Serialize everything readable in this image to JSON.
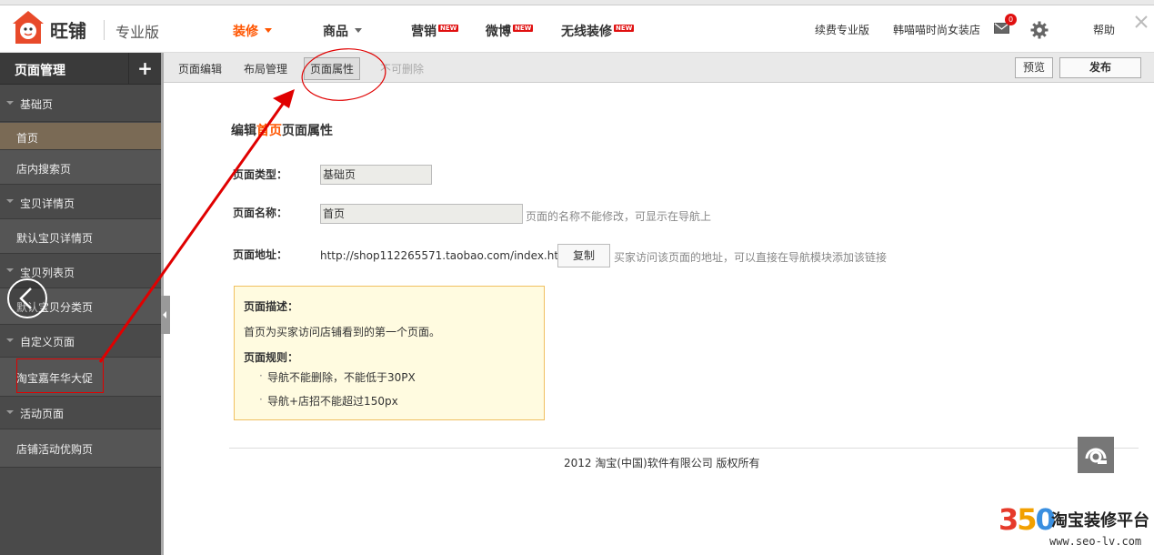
{
  "header": {
    "brand": "旺铺",
    "edition": "专业版",
    "nav": [
      {
        "label": "装修",
        "active": true,
        "has_caret": true,
        "new": false
      },
      {
        "label": "商品",
        "active": false,
        "has_caret": true,
        "new": false
      },
      {
        "label": "营销",
        "active": false,
        "has_caret": false,
        "new": true
      },
      {
        "label": "微博",
        "active": false,
        "has_caret": false,
        "new": true
      },
      {
        "label": "无线装修",
        "active": false,
        "has_caret": false,
        "new": true
      }
    ],
    "new_badge": "NEW",
    "renew": "续费专业版",
    "shop_name": "韩喵喵时尚女装店",
    "mail_count": "0",
    "help": "帮助"
  },
  "sidebar": {
    "title": "页面管理",
    "add_label": "+",
    "rows": [
      {
        "label": "基础页",
        "type": "group"
      },
      {
        "label": "首页",
        "type": "selected"
      },
      {
        "label": "店内搜索页",
        "type": "sub"
      },
      {
        "label": "宝贝详情页",
        "type": "group"
      },
      {
        "label": "默认宝贝详情页",
        "type": "sub"
      },
      {
        "label": "宝贝列表页",
        "type": "group"
      },
      {
        "label": "默认宝贝分类页",
        "type": "sub"
      },
      {
        "label": "自定义页面",
        "type": "group"
      },
      {
        "label": "淘宝嘉年华大促",
        "type": "sub"
      },
      {
        "label": "活动页面",
        "type": "group"
      },
      {
        "label": "店铺活动优购页",
        "type": "sub"
      }
    ]
  },
  "toolbar": {
    "items": [
      "页面编辑",
      "布局管理",
      "页面属性",
      "不可删除"
    ],
    "preview": "预览",
    "publish": "发布"
  },
  "form": {
    "title_pre": "编辑",
    "title_hl": "首页",
    "title_post": "页面属性",
    "type_label": "页面类型：",
    "type_value": "基础页",
    "name_label": "页面名称：",
    "name_value": "首页",
    "name_hint": "页面的名称不能修改，可显示在导航上",
    "url_label": "页面地址：",
    "url_value": "http://shop112265571.taobao.com/index.htm",
    "copy_label": "复制",
    "url_hint": "买家访问该页面的地址，可以直接在导航模块添加该链接"
  },
  "description": {
    "head": "页面描述：",
    "text": "首页为买家访问店铺看到的第一个页面。",
    "rules_head": "页面规则：",
    "rules": [
      "导航不能删除，不能低于30PX",
      "导航+店招不能超过150px"
    ]
  },
  "footer": {
    "copyright": "2012 淘宝(中国)软件有限公司 版权所有"
  },
  "watermark": {
    "number": "350",
    "name": "淘宝装修平台",
    "url": "www.seo-lv.com"
  },
  "colors": {
    "accent": "#ff5500",
    "annotation": "#e00000",
    "sidebar_bg": "#4a4a4a",
    "selected_bg": "#7a6a55"
  }
}
